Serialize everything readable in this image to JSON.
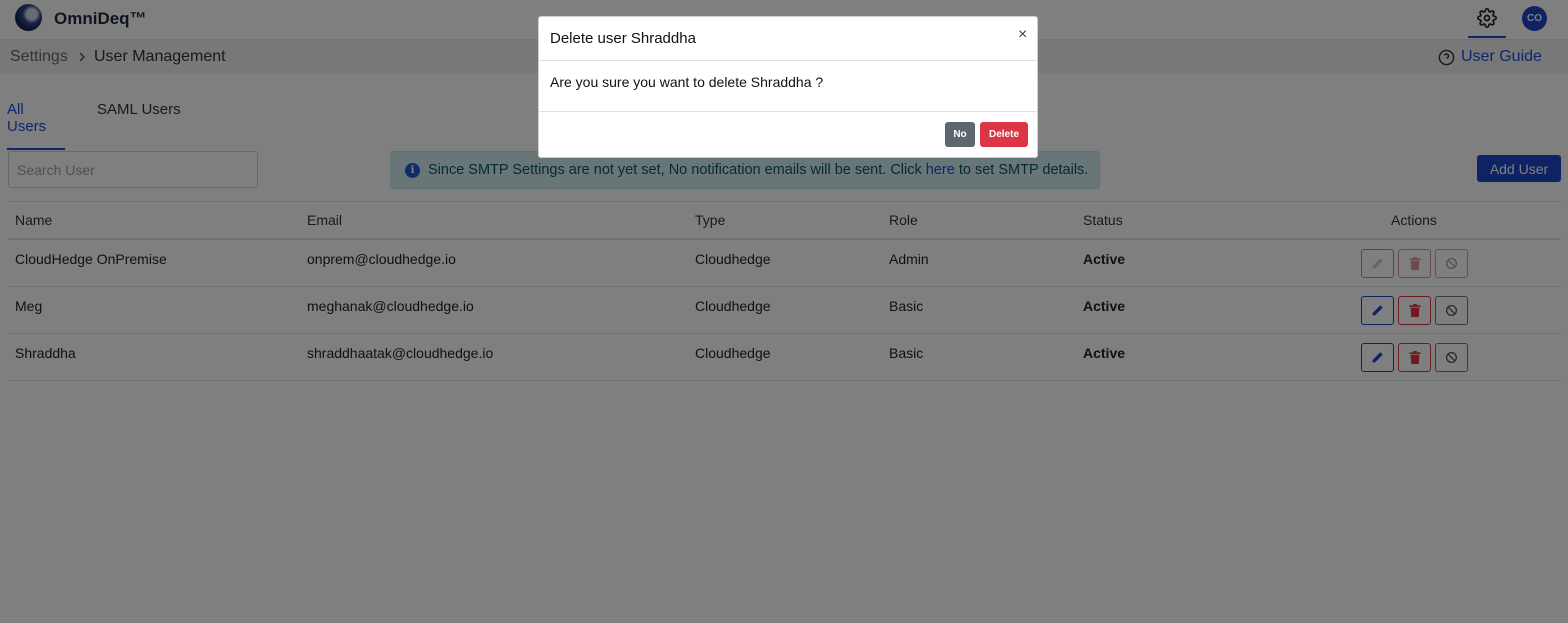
{
  "app": {
    "name": "OmniDeq™",
    "avatar_initials": "CO"
  },
  "breadcrumb": {
    "parent": "Settings",
    "current": "User Management"
  },
  "header": {
    "guide_label": "User Guide"
  },
  "tabs": [
    {
      "label": "All Users",
      "active": true
    },
    {
      "label": "SAML Users",
      "active": false
    }
  ],
  "search": {
    "placeholder": "Search User",
    "value": ""
  },
  "alert": {
    "text_before": "Since SMTP Settings are not yet set, No notification emails will be sent. Click ",
    "link": "here",
    "text_after": " to set SMTP details."
  },
  "toolbar": {
    "add_user_label": "Add User"
  },
  "table": {
    "columns": {
      "name": "Name",
      "email": "Email",
      "type": "Type",
      "role": "Role",
      "status": "Status",
      "actions": "Actions"
    },
    "rows": [
      {
        "name": "CloudHedge OnPremise",
        "email": "onprem@cloudhedge.io",
        "type": "Cloudhedge",
        "role": "Admin",
        "status": "Active"
      },
      {
        "name": "Meg",
        "email": "meghanak@cloudhedge.io",
        "type": "Cloudhedge",
        "role": "Basic",
        "status": "Active"
      },
      {
        "name": "Shraddha",
        "email": "shraddhaatak@cloudhedge.io",
        "type": "Cloudhedge",
        "role": "Basic",
        "status": "Active"
      }
    ]
  },
  "modal": {
    "title": "Delete user Shraddha",
    "close": "×",
    "body": "Are you sure you want to delete Shraddha ?",
    "no_label": "No",
    "delete_label": "Delete"
  },
  "colors": {
    "primary": "#1e46c8",
    "danger": "#dc3545",
    "success": "#1e8a36",
    "secondary": "#5f676e"
  }
}
